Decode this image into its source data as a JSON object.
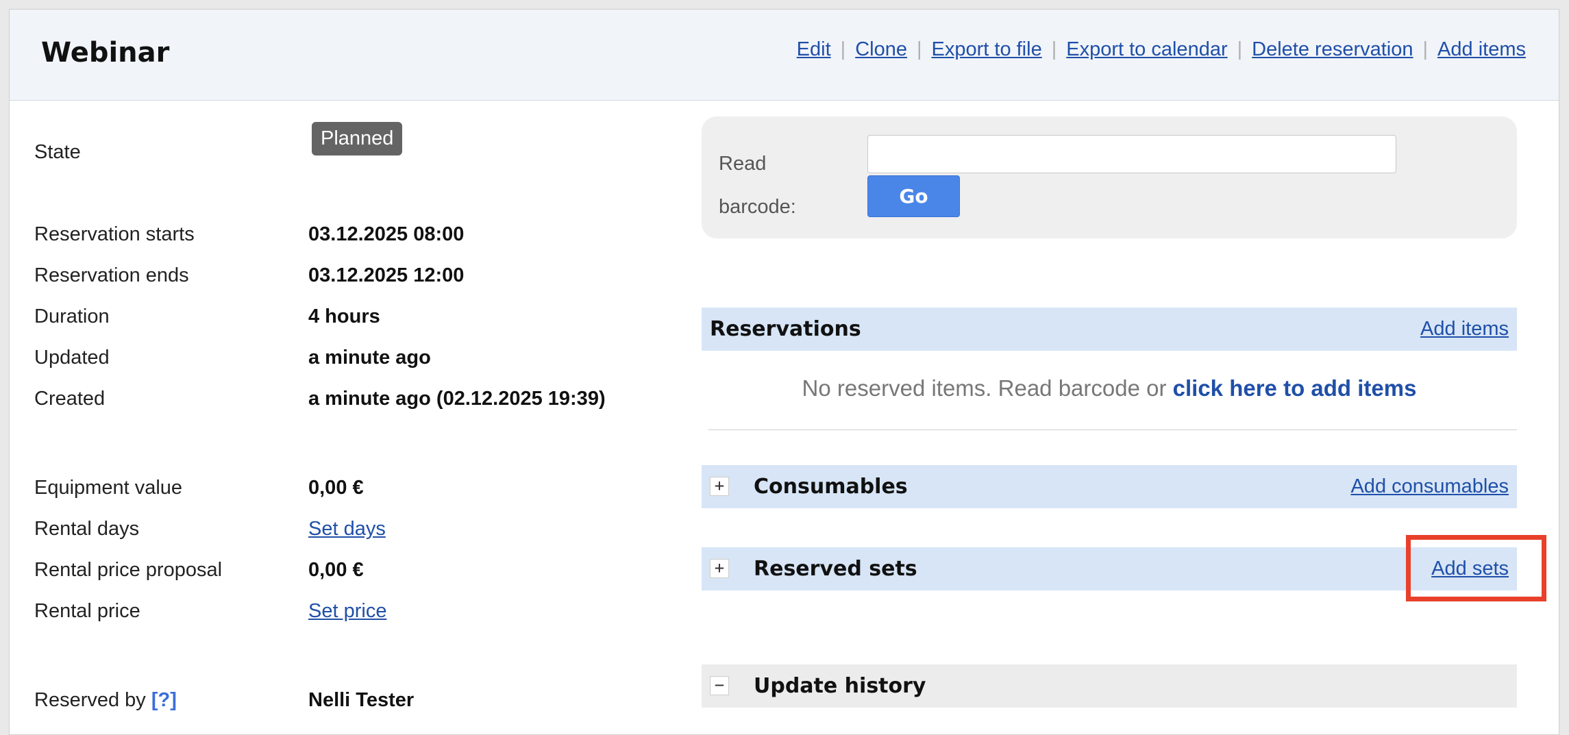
{
  "header": {
    "title": "Webinar",
    "actions": [
      "Edit",
      "Clone",
      "Export to file",
      "Export to calendar",
      "Delete reservation",
      "Add items"
    ]
  },
  "details": {
    "state_label": "State",
    "state_value": "Planned",
    "starts_label": "Reservation starts",
    "starts_value": "03.12.2025 08:00",
    "ends_label": "Reservation ends",
    "ends_value": "03.12.2025 12:00",
    "duration_label": "Duration",
    "duration_value": "4 hours",
    "updated_label": "Updated",
    "updated_value": "a minute ago",
    "created_label": "Created",
    "created_value": "a minute ago (02.12.2025 19:39)",
    "equipment_label": "Equipment value",
    "equipment_value": "0,00 €",
    "rental_days_label": "Rental days",
    "rental_days_link": "Set days",
    "proposal_label": "Rental price proposal",
    "proposal_value": "0,00 €",
    "rental_price_label": "Rental price",
    "rental_price_link": "Set price",
    "reserved_by_label": "Reserved by",
    "reserved_by_help": "[?]",
    "reserved_by_value": "Nelli Tester"
  },
  "barcode": {
    "label_line1": "Read",
    "label_line2": "barcode:",
    "input_value": "",
    "go_label": "Go"
  },
  "sections": {
    "reservations": {
      "title": "Reservations",
      "action": "Add items"
    },
    "no_items_text": "No reserved items. Read barcode or",
    "no_items_link": "click here to add items",
    "consumables": {
      "title": "Consumables",
      "action": "Add consumables",
      "toggle": "+"
    },
    "reserved_sets": {
      "title": "Reserved sets",
      "action": "Add sets",
      "toggle": "+"
    },
    "update_history": {
      "title": "Update history",
      "toggle": "−"
    }
  },
  "colors": {
    "link": "#1f4fa8",
    "section_bg": "#d7e5f6",
    "badge_bg": "#646464",
    "go_button": "#4a86e8",
    "highlight": "#e8402a"
  }
}
